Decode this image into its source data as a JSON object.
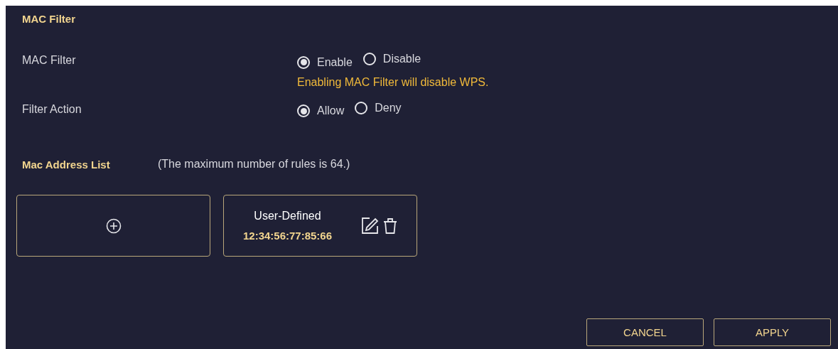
{
  "section_title": "MAC Filter",
  "fields": [
    {
      "label": "MAC Filter",
      "options": [
        {
          "label": "Enable",
          "selected": true
        },
        {
          "label": "Disable",
          "selected": false
        }
      ],
      "note": "Enabling MAC Filter will disable WPS."
    },
    {
      "label": "Filter Action",
      "options": [
        {
          "label": "Allow",
          "selected": true
        },
        {
          "label": "Deny",
          "selected": false
        }
      ]
    }
  ],
  "mac_list": {
    "title": "Mac Address List",
    "note": "(The maximum number of rules is 64.)",
    "cards": [
      {
        "kind": "add"
      },
      {
        "kind": "entry",
        "name": "User-Defined",
        "mac": "12:34:56:77:85:66"
      }
    ]
  },
  "buttons": [
    "CANCEL",
    "APPLY"
  ]
}
